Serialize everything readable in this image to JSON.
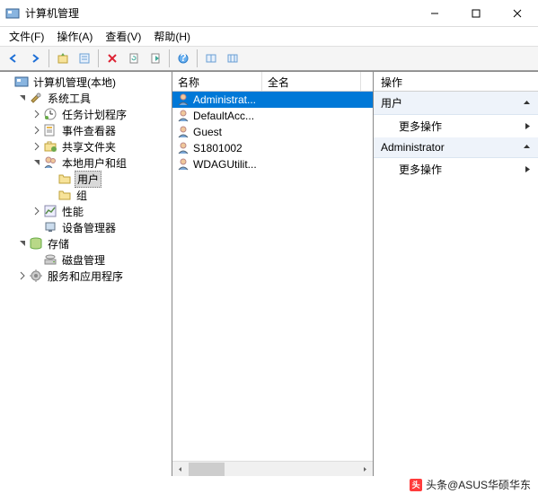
{
  "window": {
    "title": "计算机管理",
    "min": "—",
    "max": "□",
    "close": "✕"
  },
  "menubar": [
    {
      "label": "文件(F)"
    },
    {
      "label": "操作(A)"
    },
    {
      "label": "查看(V)"
    },
    {
      "label": "帮助(H)"
    }
  ],
  "toolbar_icons": [
    "back",
    "forward",
    "up",
    "properties",
    "delete",
    "refresh",
    "export",
    "help",
    "show-hide",
    "tile"
  ],
  "tree": {
    "root": "计算机管理(本地)",
    "nodes": [
      {
        "label": "系统工具",
        "icon": "tools",
        "expanded": true,
        "depth": 1,
        "children": [
          {
            "label": "任务计划程序",
            "icon": "clock",
            "expandable": true,
            "depth": 2
          },
          {
            "label": "事件查看器",
            "icon": "event",
            "expandable": true,
            "depth": 2
          },
          {
            "label": "共享文件夹",
            "icon": "share",
            "expandable": true,
            "depth": 2
          },
          {
            "label": "本地用户和组",
            "icon": "users",
            "expanded": true,
            "depth": 2,
            "children": [
              {
                "label": "用户",
                "icon": "folder",
                "depth": 3,
                "selected": true
              },
              {
                "label": "组",
                "icon": "folder",
                "depth": 3
              }
            ]
          },
          {
            "label": "性能",
            "icon": "perf",
            "expandable": true,
            "depth": 2
          },
          {
            "label": "设备管理器",
            "icon": "device",
            "depth": 2
          }
        ]
      },
      {
        "label": "存储",
        "icon": "storage",
        "expanded": true,
        "depth": 1,
        "children": [
          {
            "label": "磁盘管理",
            "icon": "disk",
            "depth": 2
          }
        ]
      },
      {
        "label": "服务和应用程序",
        "icon": "services",
        "expandable": true,
        "depth": 1
      }
    ]
  },
  "list": {
    "columns": [
      {
        "label": "名称",
        "width": 100
      },
      {
        "label": "全名",
        "width": 110
      }
    ],
    "rows": [
      {
        "name": "Administrat...",
        "fullname": "",
        "selected": true
      },
      {
        "name": "DefaultAcc...",
        "fullname": ""
      },
      {
        "name": "Guest",
        "fullname": ""
      },
      {
        "name": "S1801002",
        "fullname": ""
      },
      {
        "name": "WDAGUtilit...",
        "fullname": ""
      }
    ]
  },
  "actions": {
    "header": "操作",
    "groups": [
      {
        "title": "用户",
        "items": [
          {
            "label": "更多操作"
          }
        ]
      },
      {
        "title": "Administrator",
        "items": [
          {
            "label": "更多操作"
          }
        ]
      }
    ]
  },
  "watermark": {
    "prefix": "头条",
    "text": "@ASUS华硕华东"
  }
}
